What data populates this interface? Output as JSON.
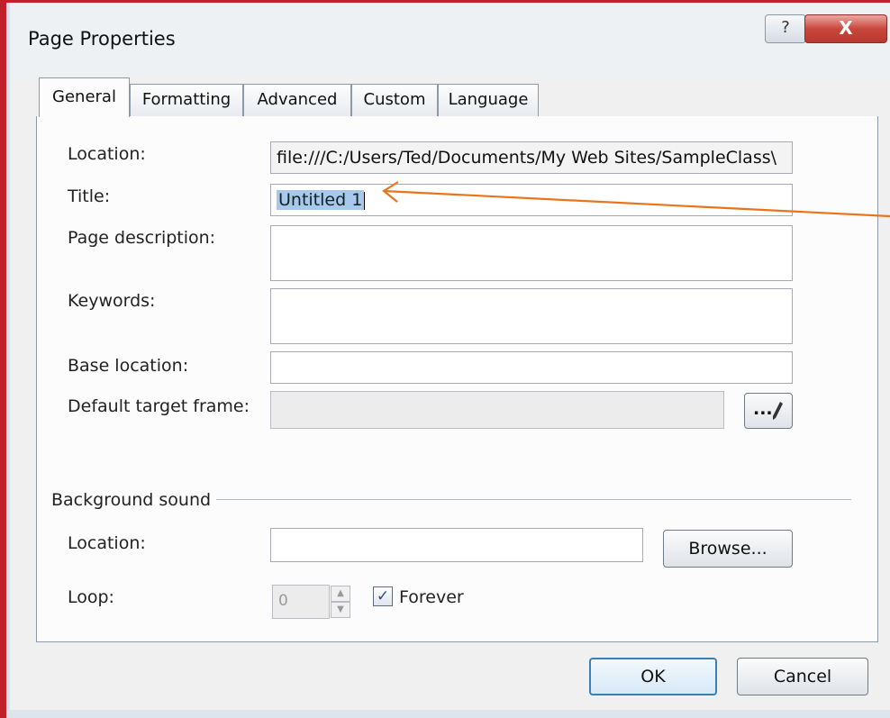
{
  "window": {
    "title": "Page Properties",
    "help_symbol": "?",
    "close_symbol": "X"
  },
  "tabs": [
    {
      "label": "General",
      "active": true
    },
    {
      "label": "Formatting",
      "active": false
    },
    {
      "label": "Advanced",
      "active": false
    },
    {
      "label": "Custom",
      "active": false
    },
    {
      "label": "Language",
      "active": false
    }
  ],
  "general": {
    "location_label": "Location:",
    "location_value": "file:///C:/Users/Ted/Documents/My Web Sites/SampleClass\\",
    "title_label": "Title:",
    "title_value": "Untitled 1",
    "description_label": "Page description:",
    "description_value": "",
    "keywords_label": "Keywords:",
    "keywords_value": "",
    "base_location_label": "Base location:",
    "base_location_value": "",
    "target_frame_label": "Default target frame:",
    "target_frame_value": "",
    "target_frame_button": "...",
    "target_frame_icon": "pencil-icon"
  },
  "background_sound": {
    "group_label": "Background sound",
    "location_label": "Location:",
    "location_value": "",
    "browse_label": "Browse...",
    "loop_label": "Loop:",
    "loop_value": "0",
    "forever_label": "Forever",
    "forever_checked": true
  },
  "footer": {
    "ok_label": "OK",
    "cancel_label": "Cancel"
  },
  "annotation": {
    "color": "#e8741c"
  }
}
